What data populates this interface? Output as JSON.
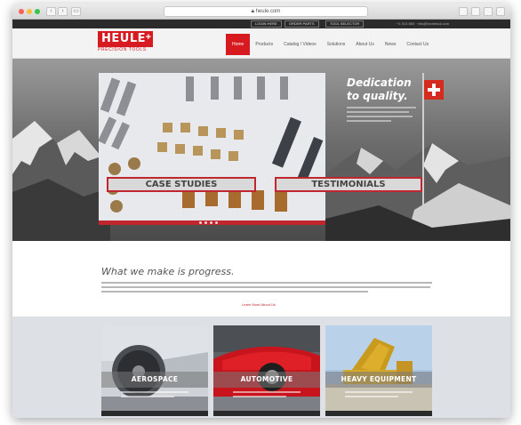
{
  "browser": {
    "url": "heule.com",
    "back_label": "‹",
    "forward_label": "›",
    "sidebar_label": "▭"
  },
  "topbar": {
    "buttons": [
      "LOGIN HERE",
      "ORDER PARTS",
      "TOOL SELECTOR"
    ],
    "contact": "+1 513 860 · info@heuletool.com"
  },
  "brand": {
    "name": "HEULE",
    "plus": "+",
    "tagline": "PRECISION TOOLS",
    "accent_color": "#d71920"
  },
  "nav": {
    "items": [
      "Home",
      "Products",
      "Catalog / Videos",
      "Solutions",
      "About Us",
      "News",
      "Contact Us"
    ],
    "active_index": 0
  },
  "hero": {
    "title_line1": "Dedication",
    "title_line2": "to quality.",
    "buttons": [
      "CASE STUDIES",
      "TESTIMONIALS"
    ]
  },
  "progress": {
    "title": "What we make is progress.",
    "learn_more": "Learn More About Us"
  },
  "industries": [
    {
      "label": "AEROSPACE",
      "image_icon": "jet-engine-icon"
    },
    {
      "label": "AUTOMOTIVE",
      "image_icon": "sports-car-icon"
    },
    {
      "label": "HEAVY EQUIPMENT",
      "image_icon": "dump-truck-icon"
    }
  ]
}
